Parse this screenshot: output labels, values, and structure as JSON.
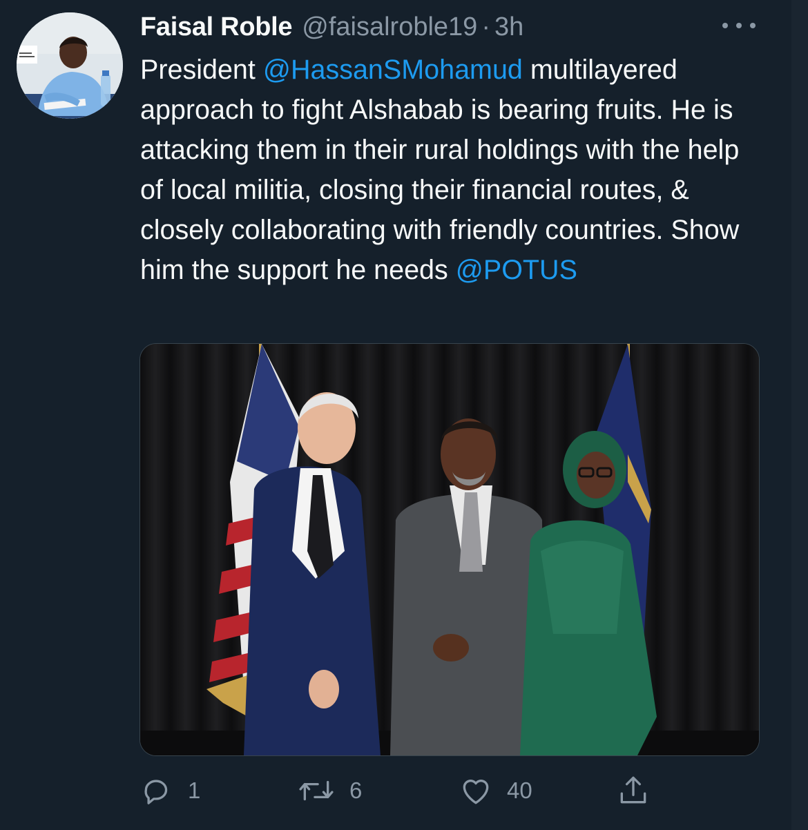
{
  "tweet": {
    "author_name": "Faisal Roble",
    "handle": "@faisalroble19",
    "separator": "·",
    "time": "3h",
    "text_parts": {
      "p1": "President ",
      "m1": "@HassanSMohamud",
      "p2": " multilayered approach to fight Alshabab is  bearing fruits. He is attacking them in their rural holdings with the help of local militia, closing their financial routes, & closely collaborating with friendly countries. Show him the support he needs ",
      "m2": "@POTUS"
    },
    "icons": {
      "more": "more-horizontal-icon",
      "reply": "reply-icon",
      "retweet": "retweet-icon",
      "like": "heart-icon",
      "share": "share-icon"
    }
  },
  "actions": {
    "reply_count": "1",
    "retweet_count": "6",
    "like_count": "40"
  },
  "colors": {
    "background": "#15202b",
    "text": "#f7f9f9",
    "secondary": "#8b98a5",
    "link": "#1d9bf0"
  }
}
